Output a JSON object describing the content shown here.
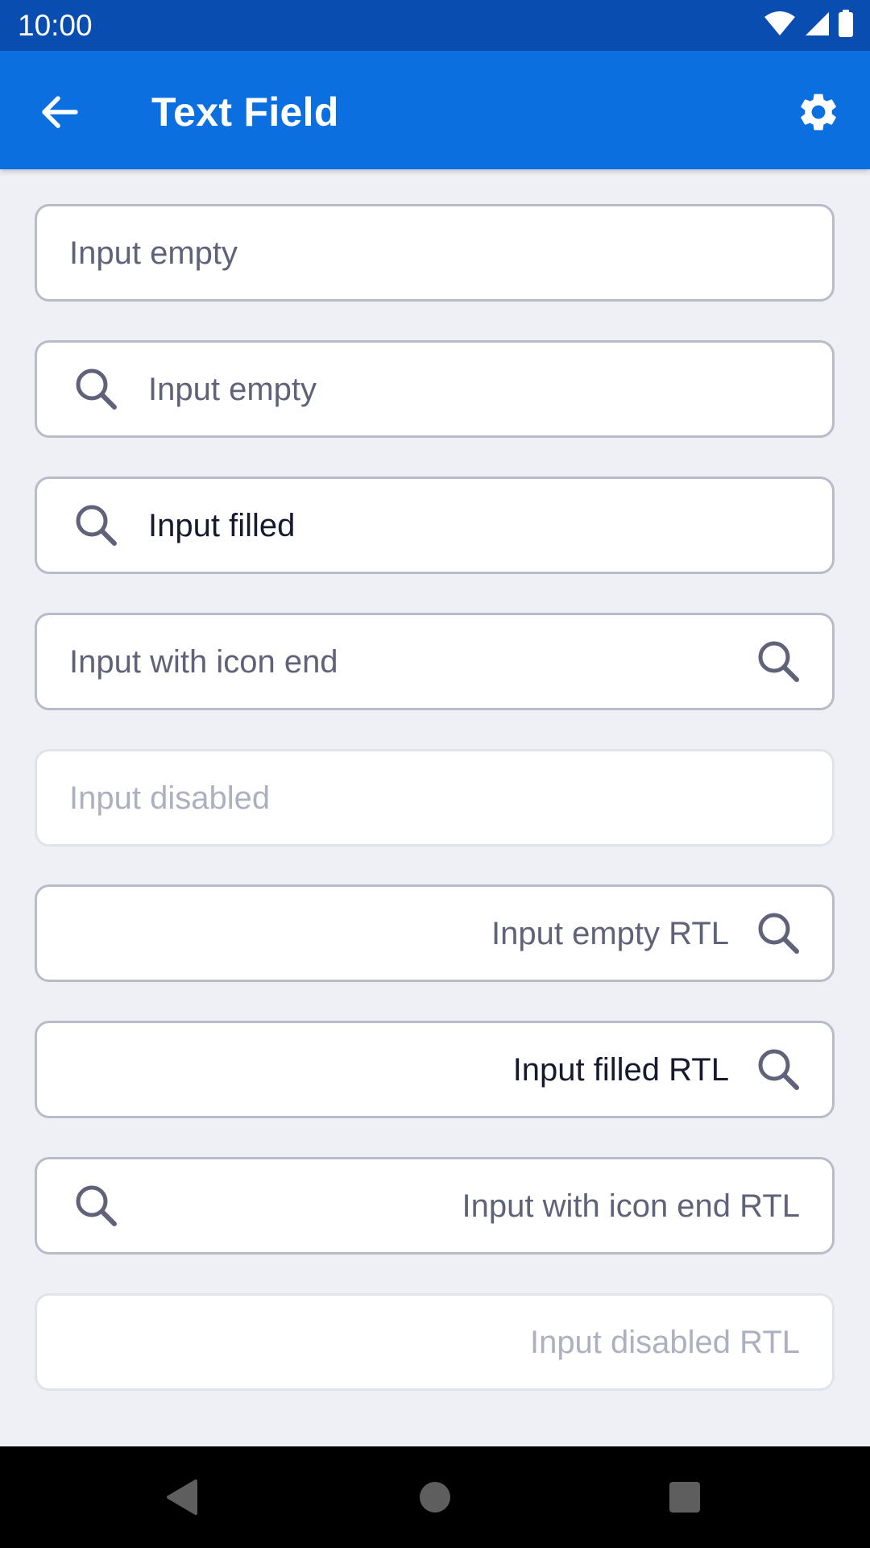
{
  "status_bar": {
    "time": "10:00",
    "icons": [
      "wifi-icon",
      "cell-signal-icon",
      "battery-icon"
    ]
  },
  "app_bar": {
    "title": "Text Field",
    "back_icon": "arrow-back-icon",
    "settings_icon": "gear-icon"
  },
  "fields": [
    {
      "text": "Input empty",
      "state": "empty",
      "icon": "none",
      "direction": "ltr"
    },
    {
      "text": "Input empty",
      "state": "empty",
      "icon": "search-icon",
      "icon_position": "start",
      "direction": "ltr"
    },
    {
      "text": "Input filled",
      "state": "filled",
      "icon": "search-icon",
      "icon_position": "start",
      "direction": "ltr"
    },
    {
      "text": "Input with icon end",
      "state": "empty",
      "icon": "search-icon",
      "icon_position": "end",
      "direction": "ltr"
    },
    {
      "text": "Input disabled",
      "state": "disabled",
      "icon": "none",
      "direction": "ltr"
    },
    {
      "text": "Input empty RTL",
      "state": "empty",
      "icon": "search-icon",
      "icon_position": "start",
      "direction": "rtl"
    },
    {
      "text": "Input filled RTL",
      "state": "filled",
      "icon": "search-icon",
      "icon_position": "start",
      "direction": "rtl"
    },
    {
      "text": "Input with icon end RTL",
      "state": "empty",
      "icon": "search-icon",
      "icon_position": "end",
      "direction": "rtl"
    },
    {
      "text": "Input disabled RTL",
      "state": "disabled",
      "icon": "none",
      "direction": "rtl"
    }
  ],
  "nav_bar": {
    "icons": [
      "back-triangle-icon",
      "home-circle-icon",
      "recents-square-icon"
    ]
  },
  "colors": {
    "status_bar": "#0a4db1",
    "app_bar": "#0b6fe0",
    "background": "#eff0f5",
    "field_border": "#b9bbc9",
    "placeholder": "#5f6278",
    "filled_text": "#17192e",
    "disabled_text": "#aeb0c1",
    "icon": "#5f6278"
  }
}
